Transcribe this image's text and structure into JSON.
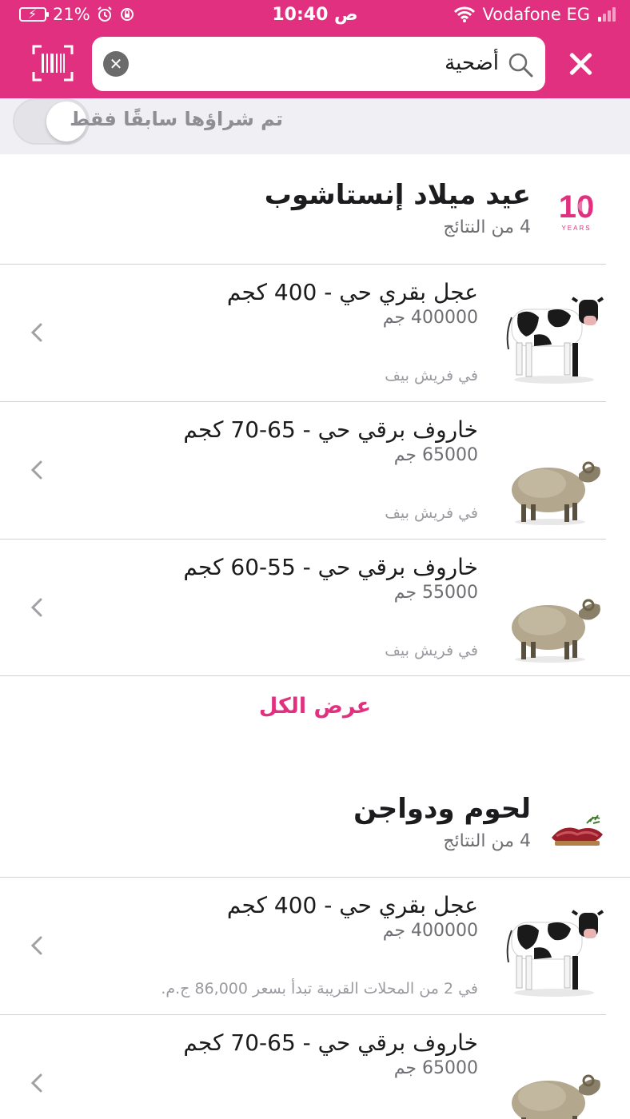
{
  "status_bar": {
    "battery_percent": "21%",
    "time": "10:40 ص",
    "carrier": "Vodafone EG"
  },
  "search": {
    "query": "أضحية",
    "clear_icon": "clear-icon",
    "close_icon": "close-icon",
    "barcode_icon": "barcode-scanner-icon"
  },
  "filter": {
    "label": "تم شراؤها سابقًا فقط",
    "enabled": false
  },
  "sections": [
    {
      "title": "عيد ميلاد إنستاشوب",
      "count": "4 من النتائج",
      "logo": "10-years-logo",
      "logo_text": "10",
      "logo_subtext": "YEARS",
      "products": [
        {
          "name": "عجل بقري حي - 400 كجم",
          "price": "400000 جم",
          "store": "في فريش بيف",
          "image": "cow-image"
        },
        {
          "name": "خاروف برقي حي - 65-70 كجم",
          "price": "65000 جم",
          "store": "في فريش بيف",
          "image": "sheep-image"
        },
        {
          "name": "خاروف برقي حي - 55-60 كجم",
          "price": "55000 جم",
          "store": "في فريش بيف",
          "image": "sheep-image"
        }
      ],
      "view_all": "عرض الكل"
    },
    {
      "title": "لحوم ودواجن",
      "count": "4 من النتائج",
      "logo": "meat-icon",
      "products": [
        {
          "name": "عجل بقري حي - 400 كجم",
          "price": "400000 جم",
          "store": "في 2 من المحلات القريبة تبدأ بسعر 86,000 ج.م.",
          "image": "cow-image"
        },
        {
          "name": "خاروف برقي حي - 65-70 كجم",
          "price": "65000 جم",
          "store": "",
          "image": "sheep-image"
        }
      ]
    }
  ],
  "colors": {
    "brand": "#e0307f",
    "filter_bg": "#efeff4",
    "secondary_text": "#6e6e73"
  }
}
